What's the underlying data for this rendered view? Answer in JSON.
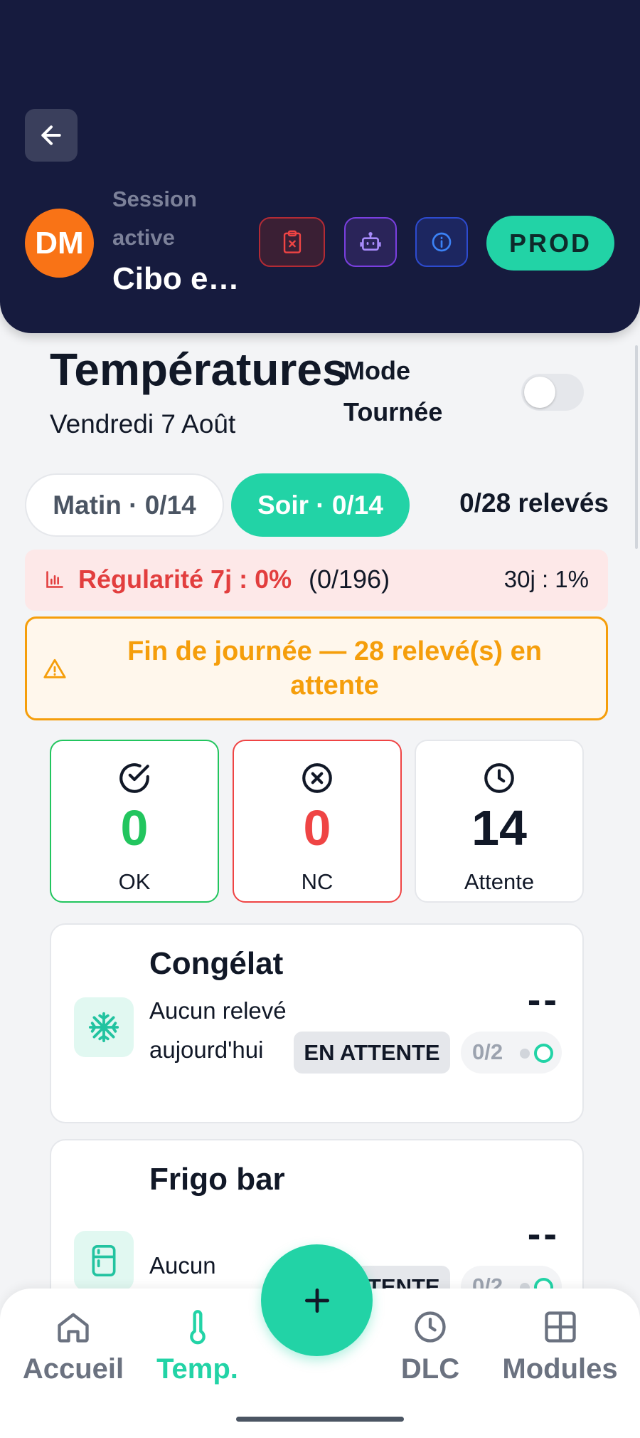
{
  "header": {
    "session_label": "Session active",
    "session_name": "Cibo e…",
    "avatar_initials": "DM",
    "env_badge": "PROD",
    "colors": {
      "background": "#161b3e",
      "accent": "#22d3a6",
      "avatar": "#f97316"
    }
  },
  "page": {
    "title": "Températures",
    "date": "Vendredi 7 Août",
    "mode_label": "Mode Tournée",
    "mode_enabled": false
  },
  "shifts": {
    "matin": "Matin · 0/14",
    "soir": "Soir · 0/14",
    "active": "soir",
    "total": "0/28 relevés"
  },
  "regularity": {
    "main": "Régularité 7j : 0%",
    "count": "(0/196)",
    "thirty_days": "30j : 1%"
  },
  "warning": {
    "text": "Fin de journée — 28 relevé(s) en attente"
  },
  "stats": [
    {
      "value": "0",
      "label": "OK",
      "icon": "check-circle-icon"
    },
    {
      "value": "0",
      "label": "NC",
      "icon": "x-circle-icon"
    },
    {
      "value": "14",
      "label": "Attente",
      "icon": "clock-icon"
    }
  ],
  "equipment": [
    {
      "name": "Congélat",
      "subtitle": "Aucun relevé aujourd'hui",
      "temperature": "--",
      "status": "EN ATTENTE",
      "progress": "0/2",
      "icon": "snowflake-icon"
    },
    {
      "name": "Frigo bar",
      "subtitle": "Aucun",
      "temperature": "--",
      "status": "EN ATTENTE",
      "progress": "0/2",
      "icon": "fridge-icon"
    }
  ],
  "nav": {
    "home": "Accueil",
    "temp": "Temp.",
    "dlc": "DLC",
    "modules": "Modules",
    "active": "temp"
  }
}
